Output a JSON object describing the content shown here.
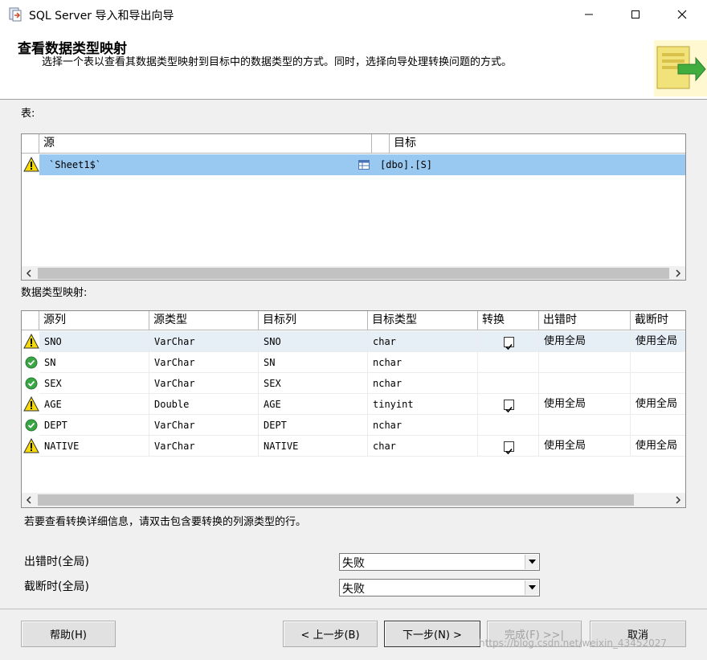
{
  "window": {
    "title": "SQL Server 导入和导出向导"
  },
  "header": {
    "title": "查看数据类型映射",
    "description": "选择一个表以查看其数据类型映射到目标中的数据类型的方式。同时，选择向导处理转换问题的方式。"
  },
  "tables_section": {
    "label": "表:",
    "columns": [
      "源",
      "目标"
    ],
    "rows": [
      {
        "status": "warning",
        "source": "`Sheet1$`",
        "target": "[dbo].[S]"
      }
    ]
  },
  "mapping_section": {
    "label": "数据类型映射:",
    "columns": [
      "源列",
      "源类型",
      "目标列",
      "目标类型",
      "转换",
      "出错时",
      "截断时"
    ],
    "rows": [
      {
        "status": "warning",
        "source_col": "SNO",
        "source_type": "VarChar",
        "dest_col": "SNO",
        "dest_type": "char",
        "convert": true,
        "on_error": "使用全局",
        "on_truncate": "使用全局"
      },
      {
        "status": "ok",
        "source_col": "SN",
        "source_type": "VarChar",
        "dest_col": "SN",
        "dest_type": "nchar",
        "convert": false,
        "on_error": "",
        "on_truncate": ""
      },
      {
        "status": "ok",
        "source_col": "SEX",
        "source_type": "VarChar",
        "dest_col": "SEX",
        "dest_type": "nchar",
        "convert": false,
        "on_error": "",
        "on_truncate": ""
      },
      {
        "status": "warning",
        "source_col": "AGE",
        "source_type": "Double",
        "dest_col": "AGE",
        "dest_type": "tinyint",
        "convert": true,
        "on_error": "使用全局",
        "on_truncate": "使用全局"
      },
      {
        "status": "ok",
        "source_col": "DEPT",
        "source_type": "VarChar",
        "dest_col": "DEPT",
        "dest_type": "nchar",
        "convert": false,
        "on_error": "",
        "on_truncate": ""
      },
      {
        "status": "warning",
        "source_col": "NATIVE",
        "source_type": "VarChar",
        "dest_col": "NATIVE",
        "dest_type": "char",
        "convert": true,
        "on_error": "使用全局",
        "on_truncate": "使用全局"
      }
    ]
  },
  "hint": "若要查看转换详细信息，请双击包含要转换的列源类型的行。",
  "global_settings": {
    "on_error_label": "出错时(全局)",
    "on_error_value": "失败",
    "on_truncate_label": "截断时(全局)",
    "on_truncate_value": "失败"
  },
  "buttons": {
    "help": "帮助(H)",
    "back": "< 上一步(B)",
    "next": "下一步(N) >",
    "finish": "完成(F) >>|",
    "cancel": "取消"
  },
  "watermark": "https://blog.csdn.net/weixin_43452027",
  "colors": {
    "selection": "#99c9f0",
    "warning": "#f5d90a",
    "ok": "#3aa545"
  }
}
